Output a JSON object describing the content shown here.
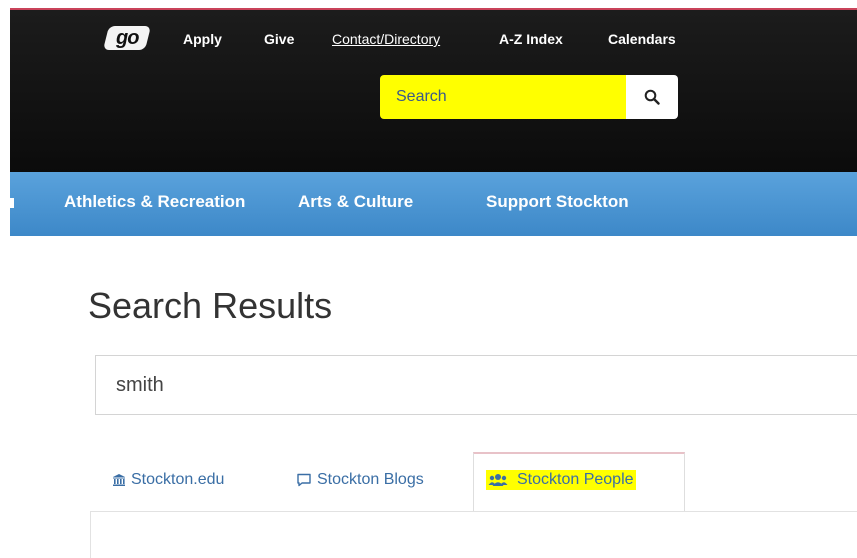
{
  "header": {
    "logo_text": "go",
    "nav": {
      "apply": "Apply",
      "give": "Give",
      "contact": "Contact/Directory",
      "az_index": "A-Z Index",
      "calendars": "Calendars"
    },
    "search": {
      "placeholder": "Search",
      "icon": "search-icon"
    }
  },
  "main_nav": {
    "athletics": "Athletics & Recreation",
    "arts": "Arts & Culture",
    "support": "Support Stockton"
  },
  "page": {
    "title": "Search Results",
    "query": "smith"
  },
  "tabs": {
    "edu": {
      "label": "Stockton.edu",
      "icon": "institution-icon"
    },
    "blogs": {
      "label": "Stockton Blogs",
      "icon": "comment-icon"
    },
    "people": {
      "label": "Stockton People",
      "icon": "users-icon",
      "active": true
    }
  },
  "colors": {
    "header_bg": "#111111",
    "nav_blue": "#4a94d2",
    "highlight": "#ffff00",
    "link": "#3a6ea5"
  }
}
